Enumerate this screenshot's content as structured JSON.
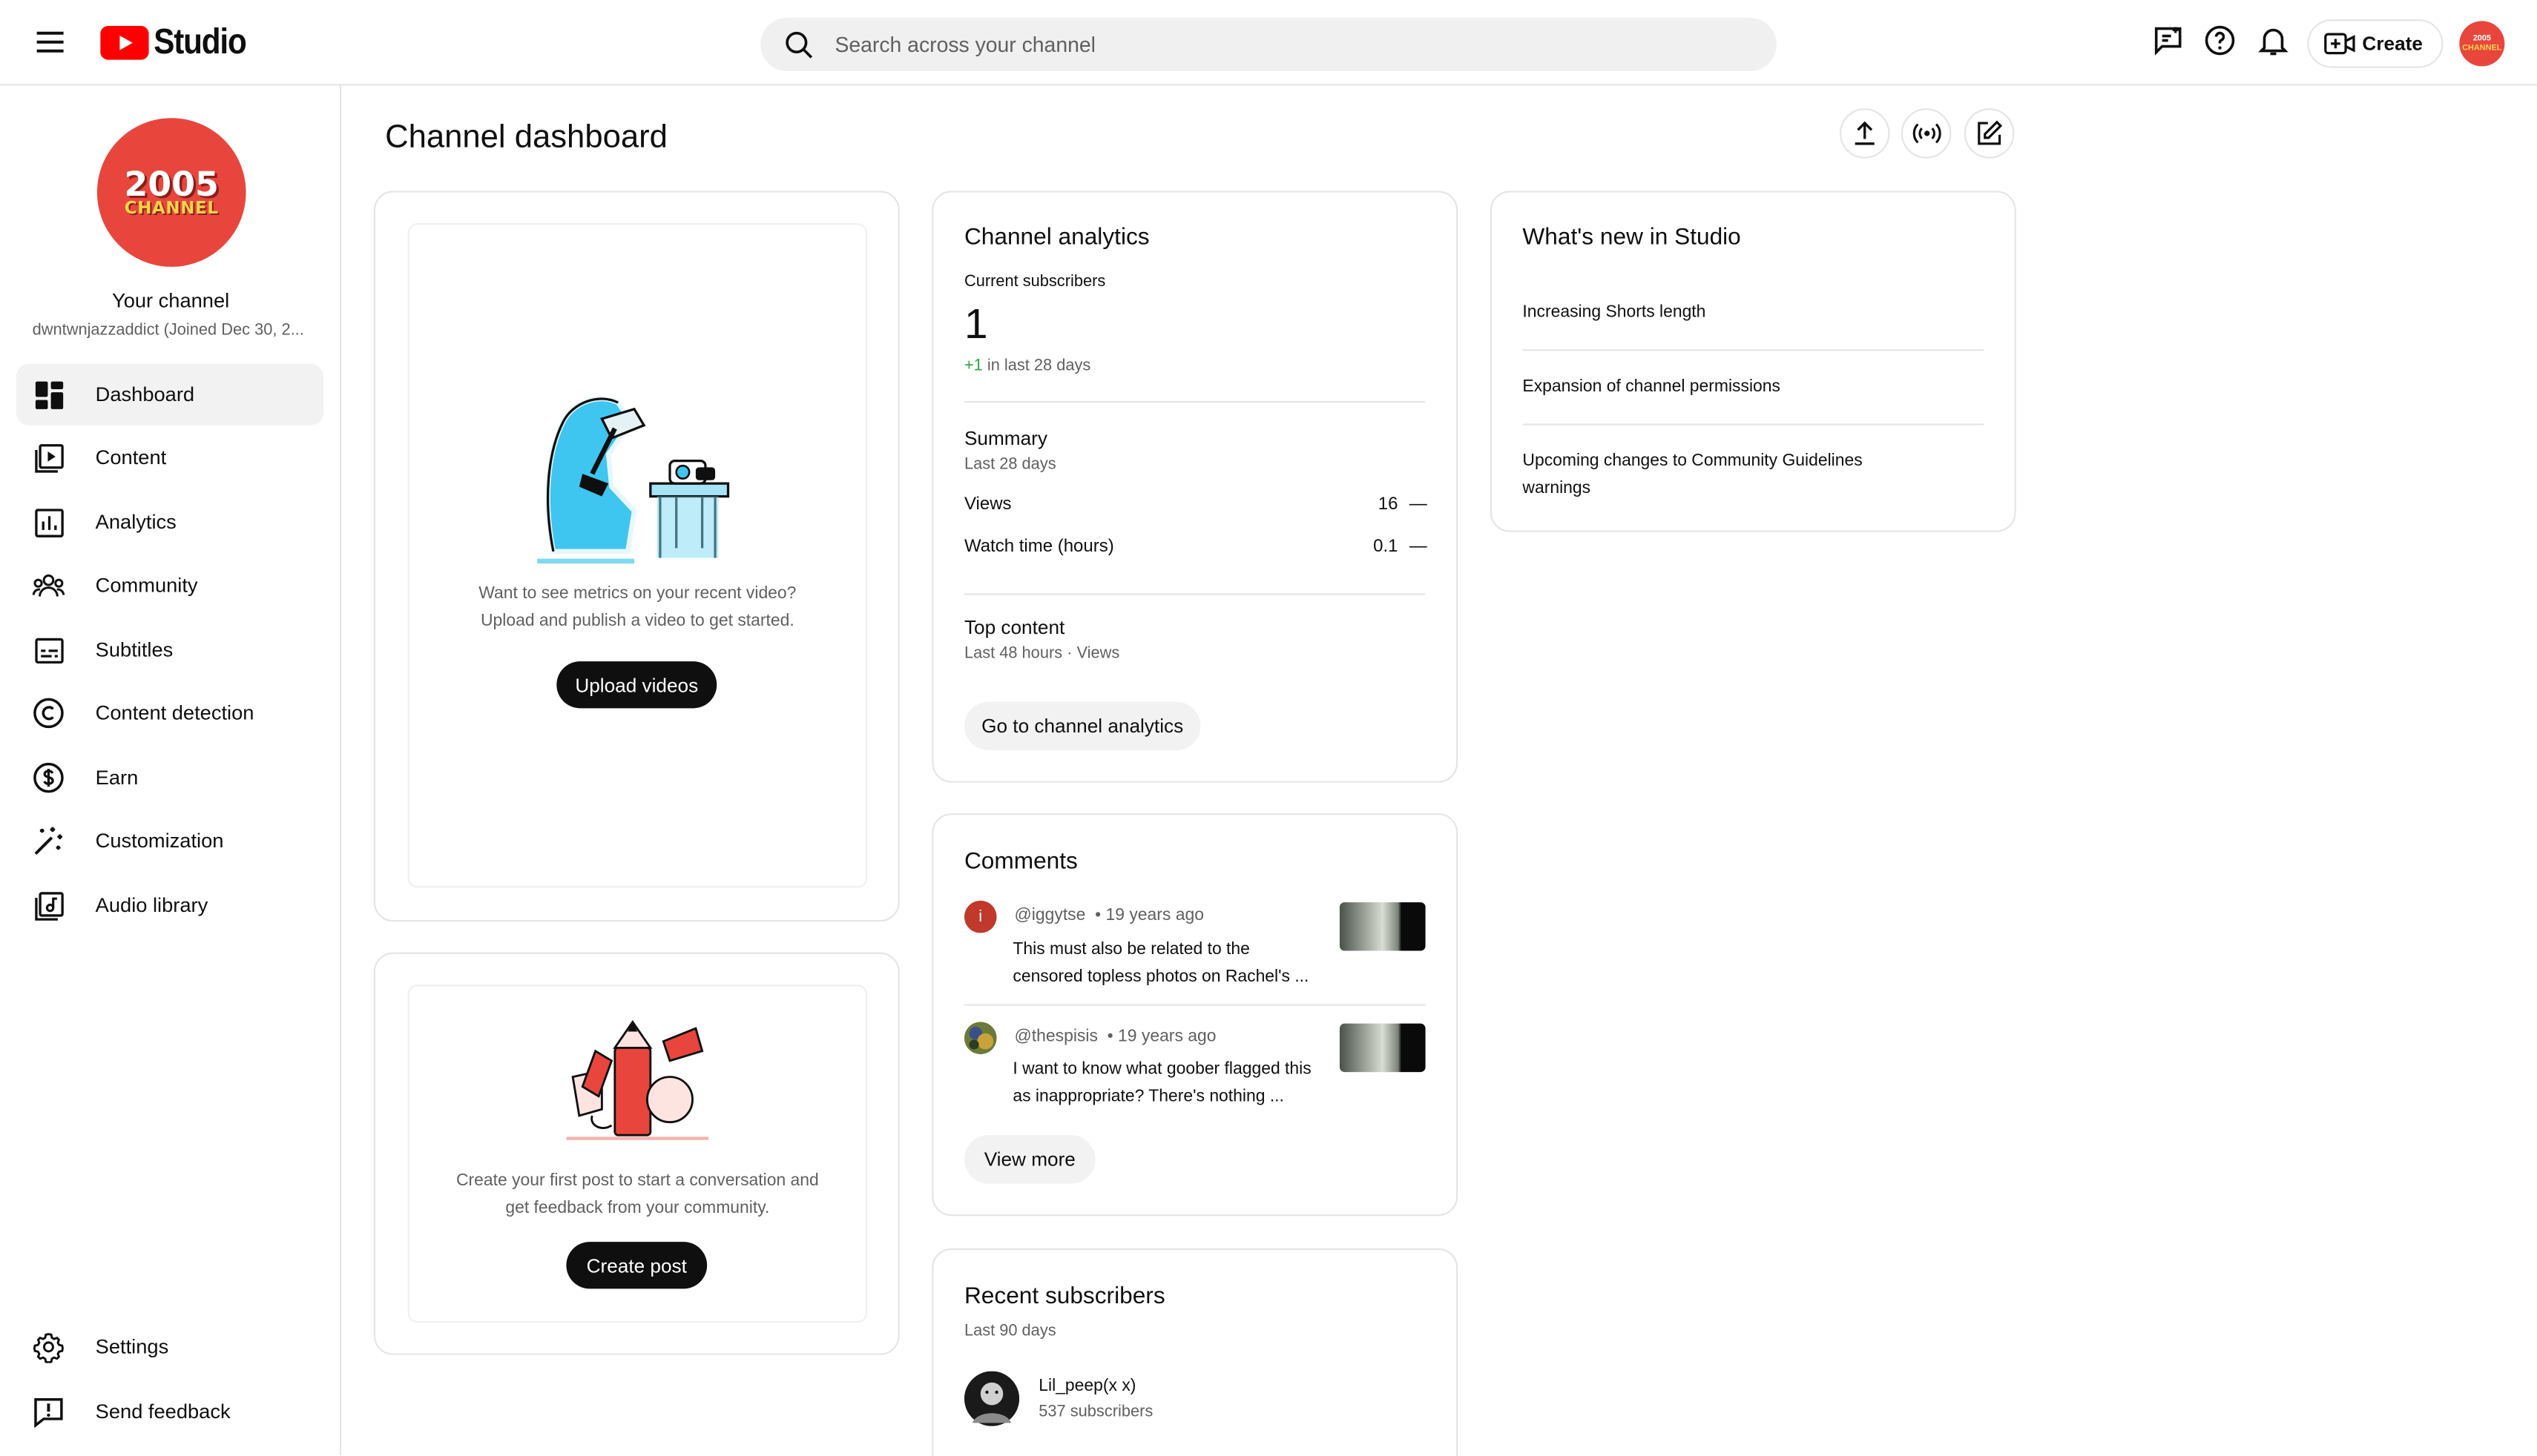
{
  "app": {
    "logo_text": "Studio"
  },
  "search": {
    "placeholder": "Search across your channel"
  },
  "header": {
    "create_label": "Create",
    "avatar_line1": "2005",
    "avatar_line2": "CHANNEL"
  },
  "channel": {
    "avatar_line1": "2005",
    "avatar_line2": "CHANNEL",
    "title": "Your channel",
    "handle": "dwntwnjazzaddict (Joined Dec 30, 2..."
  },
  "sidebar": {
    "items": [
      {
        "label": "Dashboard",
        "icon": "dashboard-icon"
      },
      {
        "label": "Content",
        "icon": "content-icon"
      },
      {
        "label": "Analytics",
        "icon": "analytics-icon"
      },
      {
        "label": "Community",
        "icon": "community-icon"
      },
      {
        "label": "Subtitles",
        "icon": "subtitles-icon"
      },
      {
        "label": "Content detection",
        "icon": "copyright-icon"
      },
      {
        "label": "Earn",
        "icon": "dollar-icon"
      },
      {
        "label": "Customization",
        "icon": "magic-wand-icon"
      },
      {
        "label": "Audio library",
        "icon": "audio-library-icon"
      }
    ],
    "bottom_items": [
      {
        "label": "Settings",
        "icon": "gear-icon"
      },
      {
        "label": "Send feedback",
        "icon": "feedback-icon"
      }
    ]
  },
  "page": {
    "title": "Channel dashboard"
  },
  "upload_card": {
    "line1": "Want to see metrics on your recent video?",
    "line2": "Upload and publish a video to get started.",
    "button": "Upload videos"
  },
  "post_card": {
    "line1": "Create your first post to start a conversation and",
    "line2": "get feedback from your community.",
    "button": "Create post"
  },
  "analytics": {
    "title": "Channel analytics",
    "subscribers_label": "Current subscribers",
    "subscribers_value": "1",
    "delta": "+1",
    "delta_suffix": "in last 28 days",
    "summary_title": "Summary",
    "summary_period": "Last 28 days",
    "rows": [
      {
        "label": "Views",
        "value": "16",
        "trend": "—"
      },
      {
        "label": "Watch time (hours)",
        "value": "0.1",
        "trend": "—"
      }
    ],
    "top_title": "Top content",
    "top_period": "Last 48 hours · Views",
    "button": "Go to channel analytics"
  },
  "comments": {
    "title": "Comments",
    "items": [
      {
        "avatar_letter": "i",
        "avatar_color": "#c0392b",
        "author": "@iggytse",
        "time": "• 19 years ago",
        "line1": "This must also be related to the",
        "line2": "censored topless photos on Rachel's ..."
      },
      {
        "avatar_letter": "",
        "avatar_color": "#6b7a3a",
        "author": "@thespisis",
        "time": "• 19 years ago",
        "line1": "I want to know what goober flagged this",
        "line2": "as inappropriate? There's nothing ..."
      }
    ],
    "button": "View more"
  },
  "recent_subscribers": {
    "title": "Recent subscribers",
    "period": "Last 90 days",
    "items": [
      {
        "name": "Lil_peep(x x)",
        "count": "537 subscribers"
      }
    ]
  },
  "whats_new": {
    "title": "What's new in Studio",
    "items": [
      {
        "line1": "Increasing Shorts length",
        "line2": ""
      },
      {
        "line1": "Expansion of channel permissions",
        "line2": ""
      },
      {
        "line1": "Upcoming changes to Community Guidelines",
        "line2": "warnings"
      }
    ]
  },
  "colors": {
    "brand_red": "#ff0000",
    "avatar_red": "#e8463d",
    "positive_green": "#2ba640"
  }
}
